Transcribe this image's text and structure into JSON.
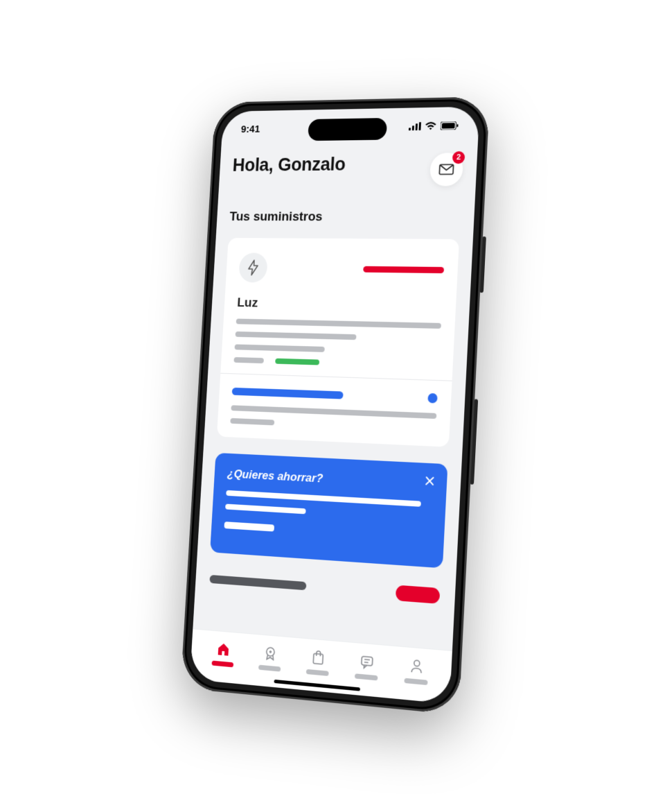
{
  "status": {
    "time": "9:41",
    "notifications_badge": "2"
  },
  "header": {
    "greeting": "Hola, Gonzalo"
  },
  "sections": {
    "supplies_title": "Tus suministros"
  },
  "supply_card": {
    "title": "Luz"
  },
  "promo": {
    "title": "¿Quieres ahorrar?"
  },
  "colors": {
    "accent": "#e4002b",
    "blue": "#2c6bed",
    "green": "#3cb95a"
  },
  "tabs": [
    {
      "name": "home",
      "active": true
    },
    {
      "name": "services",
      "active": false
    },
    {
      "name": "shop",
      "active": false
    },
    {
      "name": "chat",
      "active": false
    },
    {
      "name": "profile",
      "active": false
    }
  ]
}
